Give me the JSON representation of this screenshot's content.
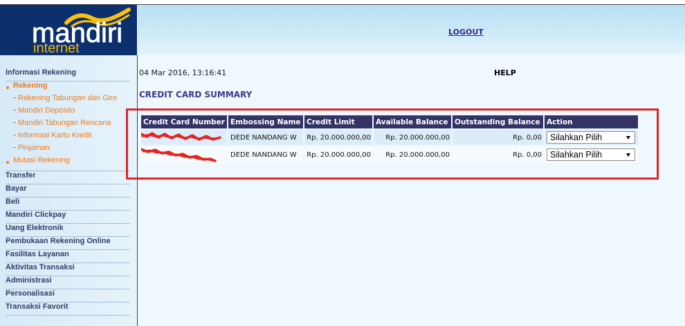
{
  "header": {
    "logo_main": "mandiri",
    "logo_sub": "internet",
    "logout_label": "LOGOUT"
  },
  "sidebar": {
    "section_label": "Informasi Rekening",
    "rekening_label": "Rekening",
    "rekening_items": [
      "Rekening Tabungan dan Giro",
      "Mandiri Deposito",
      "Mandiri Tabungan Rencana",
      "Informasi Kartu Kredit",
      "Pinjaman"
    ],
    "mutasi_label": "Mutasi Rekening",
    "menu": [
      "Transfer",
      "Bayar",
      "Beli",
      "Mandiri Clickpay",
      "Uang Elektronik",
      "Pembukaan Rekening Online",
      "Fasilitas Layanan",
      "Aktivitas Transaksi",
      "Administrasi",
      "Personalisasi",
      "Transaksi Favorit"
    ]
  },
  "main": {
    "datetime": "04 Mar 2016, 13:16:41",
    "help_label": "HELP",
    "title": "CREDIT CARD SUMMARY",
    "table": {
      "columns": [
        "Credit Card Number",
        "Embossing Name",
        "Credit Limit",
        "Available Balance",
        "Outstanding Balance",
        "Action"
      ],
      "rows": [
        {
          "embossing_name": "DEDE NANDANG W",
          "credit_limit": "Rp. 20.000.000,00",
          "available_balance": "Rp. 20.000.000,00",
          "outstanding_balance": "Rp. 0,00",
          "action_selected": "Silahkan Pilih"
        },
        {
          "embossing_name": "DEDE NANDANG W",
          "credit_limit": "Rp. 20.000.000,00",
          "available_balance": "Rp. 20.000.000,00",
          "outstanding_balance": "Rp. 0,00",
          "action_selected": "Silahkan Pilih"
        }
      ]
    }
  },
  "icons": {
    "logo_wave": "wave-icon",
    "menu_bullet": "bullet-icon",
    "submenu_dash": "dash-icon",
    "select_arrow": "caret-down-icon"
  },
  "colors": {
    "brand_navy": "#0c2f6e",
    "brand_yellow": "#f9c20a",
    "menu_orange": "#ef7a1c",
    "table_header": "#333366",
    "row_highlight": "#dcedf9",
    "annotation_red": "#e0242b"
  }
}
